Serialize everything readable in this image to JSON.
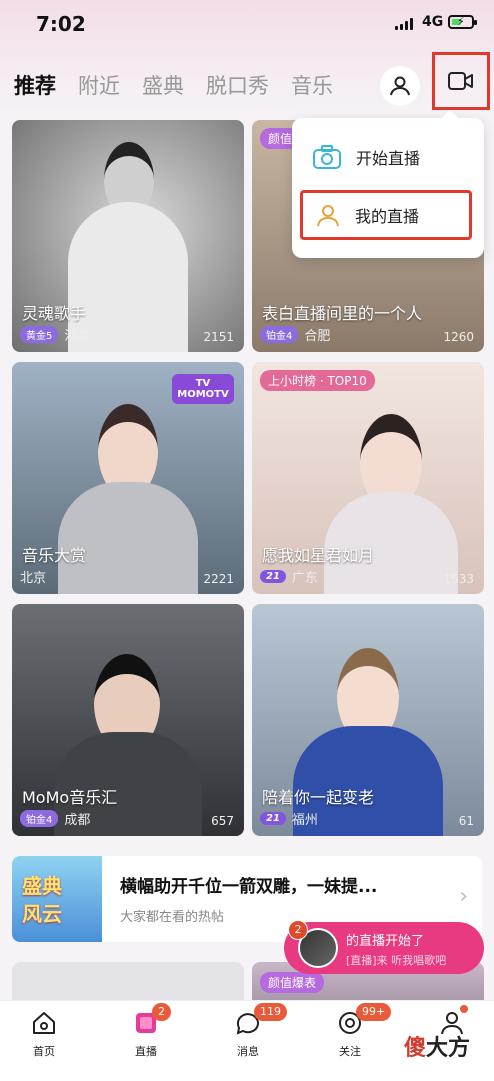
{
  "status": {
    "time": "7:02",
    "network": "4G"
  },
  "tabs": [
    {
      "label": "推荐",
      "active": true
    },
    {
      "label": "附近"
    },
    {
      "label": "盛典"
    },
    {
      "label": "脱口秀"
    },
    {
      "label": "音乐"
    }
  ],
  "popup": {
    "items": [
      {
        "label": "开始直播",
        "icon": "camera-icon"
      },
      {
        "label": "我的直播",
        "icon": "person-icon"
      }
    ]
  },
  "cards": [
    {
      "title": "灵魂歌手",
      "badge": "黄金5",
      "city": "河北",
      "count": "2151"
    },
    {
      "title": "表白直播间里的一个人",
      "tag": "颜值",
      "badge": "铂金4",
      "city": "合肥",
      "count": "1260"
    },
    {
      "title": "音乐大赏",
      "city": "北京",
      "count": "2221",
      "logo": "TV MOMOTV"
    },
    {
      "title": "愿我如星君如月",
      "tag": "上小时榜 · TOP10",
      "badge": "21",
      "city": "广东",
      "count": "1533"
    },
    {
      "title": "MoMo音乐汇",
      "badge": "铂金4",
      "city": "成都",
      "count": "657"
    },
    {
      "title": "陪着你一起变老",
      "badge": "21",
      "city": "福州",
      "count": "61"
    }
  ],
  "banner": {
    "thumb_text": [
      "盛典",
      "风云"
    ],
    "headline": "横幅助开千位一箭双雕，一妹提...",
    "sub": "大家都在看的热帖"
  },
  "toast": {
    "count": "2",
    "line1": "的直播开始了",
    "line2": "[直播]来 听我唱歌吧"
  },
  "peek": {
    "tag": "颜值爆表"
  },
  "nav": [
    {
      "label": "首页"
    },
    {
      "label": "直播",
      "badge": "2"
    },
    {
      "label": "消息",
      "badge": "119"
    },
    {
      "label": "关注",
      "badge": "99+"
    },
    {
      "label": ""
    }
  ],
  "watermark": {
    "c1": "傻",
    "c2": "大方"
  },
  "colors": {
    "accent": "#e83a80",
    "highlight": "#e0392b",
    "badge": "#e85a3a"
  }
}
